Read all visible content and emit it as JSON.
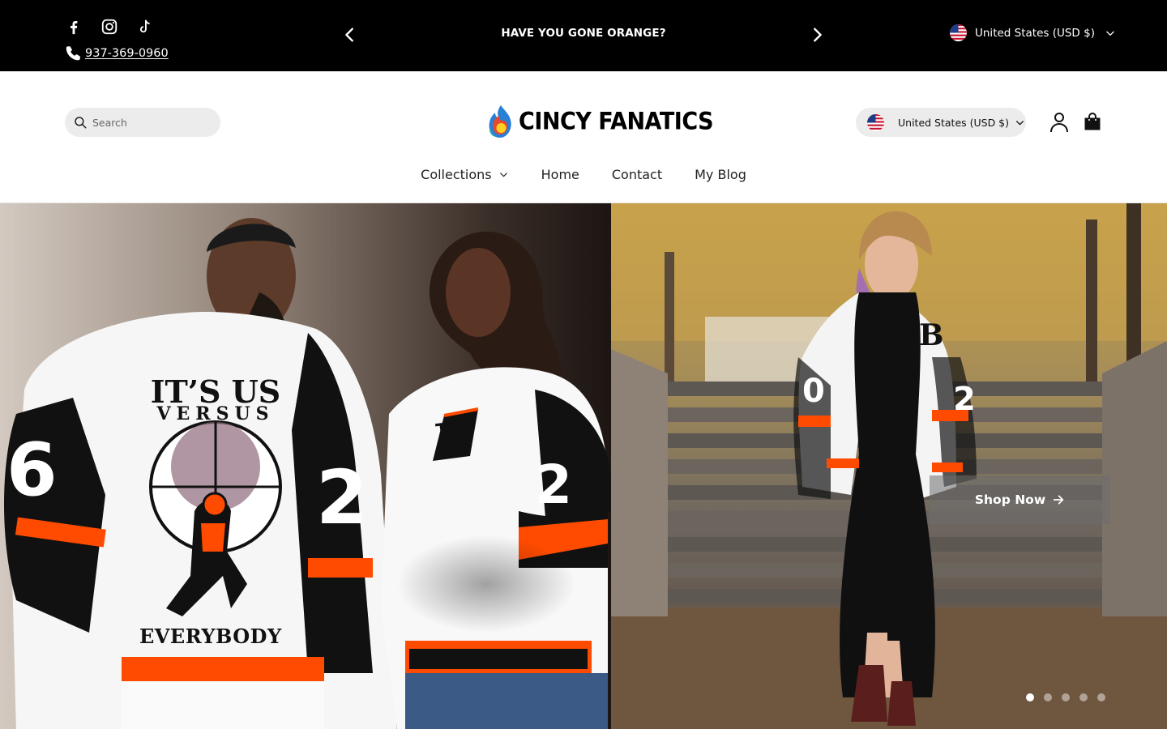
{
  "announcement": {
    "phone": "937-369-0960",
    "message": "HAVE YOU GONE ORANGE?",
    "locale": "United States (USD $)"
  },
  "social": [
    "facebook-icon",
    "instagram-icon",
    "tiktok-icon"
  ],
  "header": {
    "search_placeholder": "Search",
    "logo_text": "CINCY FANATICS",
    "locale": "United States (USD $)"
  },
  "nav": {
    "items": [
      {
        "label": "Collections",
        "has_dropdown": true
      },
      {
        "label": "Home"
      },
      {
        "label": "Contact"
      },
      {
        "label": "My Blog"
      }
    ]
  },
  "hero": {
    "jacket_text_line1": "IT’S US",
    "jacket_text_line2": "VERSUS",
    "jacket_text_line3": "EVERYBODY",
    "cta_label": "Shop Now",
    "slide_count": 5,
    "active_slide": 1
  },
  "colors": {
    "topbar_bg": "#000000",
    "accent_orange": "#ff4b00",
    "pill_bg": "#ececec"
  }
}
